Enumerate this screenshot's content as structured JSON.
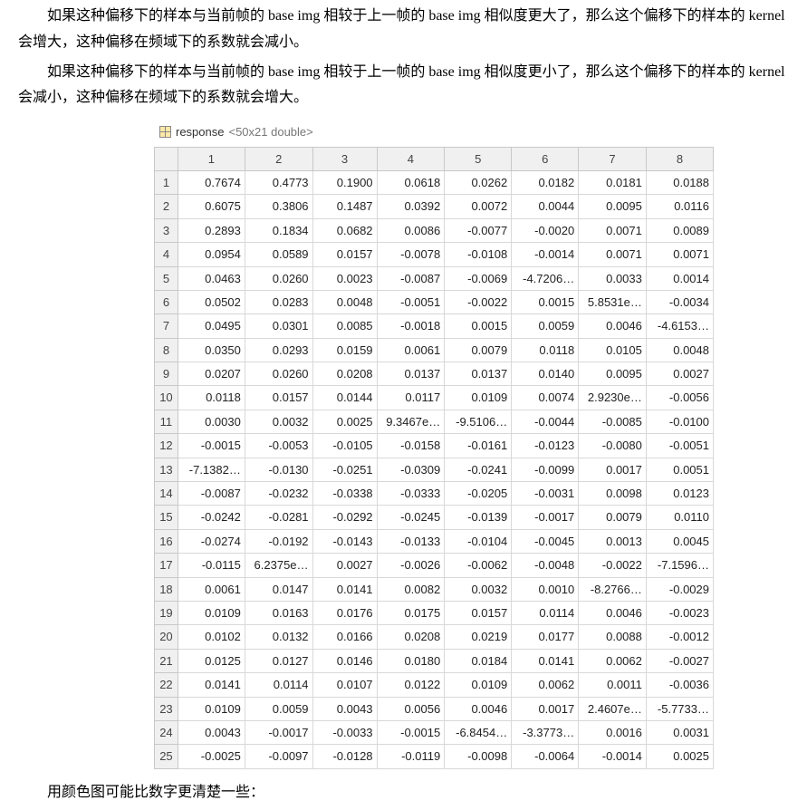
{
  "paragraphs": {
    "p1": "如果这种偏移下的样本与当前帧的 base img 相较于上一帧的 base img 相似度更大了，那么这个偏移下的样本的 kernel 会增大，这种偏移在频域下的系数就会减小。",
    "p2": "如果这种偏移下的样本与当前帧的 base img 相较于上一帧的 base img 相似度更小了，那么这个偏移下的样本的 kernel 会减小，这种偏移在频域下的系数就会增大。",
    "p3": "用颜色图可能比数字更清楚一些："
  },
  "variable": {
    "name": "response",
    "type_label": "<50x21 double>"
  },
  "columns": [
    "1",
    "2",
    "3",
    "4",
    "5",
    "6",
    "7",
    "8"
  ],
  "row_labels": [
    "1",
    "2",
    "3",
    "4",
    "5",
    "6",
    "7",
    "8",
    "9",
    "10",
    "11",
    "12",
    "13",
    "14",
    "15",
    "16",
    "17",
    "18",
    "19",
    "20",
    "21",
    "22",
    "23",
    "24",
    "25"
  ],
  "overflow_after_col8": {
    "4": "5"
  },
  "cells": {
    "r1": [
      "0.7674",
      "0.4773",
      "0.1900",
      "0.0618",
      "0.0262",
      "0.0182",
      "0.0181",
      "0.0188"
    ],
    "r2": [
      "0.6075",
      "0.3806",
      "0.1487",
      "0.0392",
      "0.0072",
      "0.0044",
      "0.0095",
      "0.0116"
    ],
    "r3": [
      "0.2893",
      "0.1834",
      "0.0682",
      "0.0086",
      "-0.0077",
      "-0.0020",
      "0.0071",
      "0.0089"
    ],
    "r4": [
      "0.0954",
      "0.0589",
      "0.0157",
      "-0.0078",
      "-0.0108",
      "-0.0014",
      "0.0071",
      "0.0071"
    ],
    "r5": [
      "0.0463",
      "0.0260",
      "0.0023",
      "-0.0087",
      "-0.0069",
      "-4.7206…",
      "0.0033",
      "0.0014"
    ],
    "r6": [
      "0.0502",
      "0.0283",
      "0.0048",
      "-0.0051",
      "-0.0022",
      "0.0015",
      "5.8531e…",
      "-0.0034"
    ],
    "r7": [
      "0.0495",
      "0.0301",
      "0.0085",
      "-0.0018",
      "0.0015",
      "0.0059",
      "0.0046",
      "-4.6153…"
    ],
    "r8": [
      "0.0350",
      "0.0293",
      "0.0159",
      "0.0061",
      "0.0079",
      "0.0118",
      "0.0105",
      "0.0048"
    ],
    "r9": [
      "0.0207",
      "0.0260",
      "0.0208",
      "0.0137",
      "0.0137",
      "0.0140",
      "0.0095",
      "0.0027"
    ],
    "r10": [
      "0.0118",
      "0.0157",
      "0.0144",
      "0.0117",
      "0.0109",
      "0.0074",
      "2.9230e…",
      "-0.0056"
    ],
    "r11": [
      "0.0030",
      "0.0032",
      "0.0025",
      "9.3467e…",
      "-9.5106…",
      "-0.0044",
      "-0.0085",
      "-0.0100"
    ],
    "r12": [
      "-0.0015",
      "-0.0053",
      "-0.0105",
      "-0.0158",
      "-0.0161",
      "-0.0123",
      "-0.0080",
      "-0.0051"
    ],
    "r13": [
      "-7.1382…",
      "-0.0130",
      "-0.0251",
      "-0.0309",
      "-0.0241",
      "-0.0099",
      "0.0017",
      "0.0051"
    ],
    "r14": [
      "-0.0087",
      "-0.0232",
      "-0.0338",
      "-0.0333",
      "-0.0205",
      "-0.0031",
      "0.0098",
      "0.0123"
    ],
    "r15": [
      "-0.0242",
      "-0.0281",
      "-0.0292",
      "-0.0245",
      "-0.0139",
      "-0.0017",
      "0.0079",
      "0.0110"
    ],
    "r16": [
      "-0.0274",
      "-0.0192",
      "-0.0143",
      "-0.0133",
      "-0.0104",
      "-0.0045",
      "0.0013",
      "0.0045"
    ],
    "r17": [
      "-0.0115",
      "6.2375e…",
      "0.0027",
      "-0.0026",
      "-0.0062",
      "-0.0048",
      "-0.0022",
      "-7.1596…"
    ],
    "r18": [
      "0.0061",
      "0.0147",
      "0.0141",
      "0.0082",
      "0.0032",
      "0.0010",
      "-8.2766…",
      "-0.0029"
    ],
    "r19": [
      "0.0109",
      "0.0163",
      "0.0176",
      "0.0175",
      "0.0157",
      "0.0114",
      "0.0046",
      "-0.0023"
    ],
    "r20": [
      "0.0102",
      "0.0132",
      "0.0166",
      "0.0208",
      "0.0219",
      "0.0177",
      "0.0088",
      "-0.0012"
    ],
    "r21": [
      "0.0125",
      "0.0127",
      "0.0146",
      "0.0180",
      "0.0184",
      "0.0141",
      "0.0062",
      "-0.0027"
    ],
    "r22": [
      "0.0141",
      "0.0114",
      "0.0107",
      "0.0122",
      "0.0109",
      "0.0062",
      "0.0011",
      "-0.0036"
    ],
    "r23": [
      "0.0109",
      "0.0059",
      "0.0043",
      "0.0056",
      "0.0046",
      "0.0017",
      "2.4607e…",
      "-5.7733…"
    ],
    "r24": [
      "0.0043",
      "-0.0017",
      "-0.0033",
      "-0.0015",
      "-6.8454…",
      "-3.3773…",
      "0.0016",
      "0.0031"
    ],
    "r25": [
      "-0.0025",
      "-0.0097",
      "-0.0128",
      "-0.0119",
      "-0.0098",
      "-0.0064",
      "-0.0014",
      "0.0025"
    ]
  }
}
